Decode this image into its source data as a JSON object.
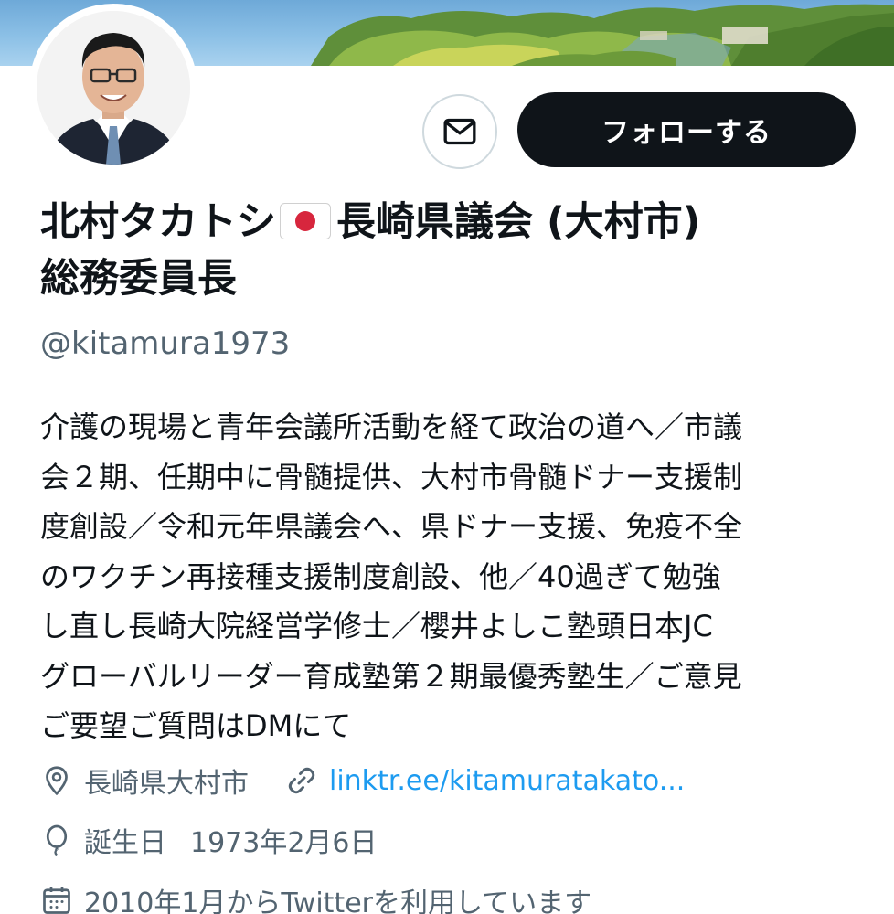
{
  "profile": {
    "name_part1": "北村タカトシ",
    "name_part2": "長崎県議会 (大村市)",
    "name_line2": "総務委員長",
    "flag_icon": "japan-flag-icon",
    "handle": "@kitamura1973",
    "bio": "介護の現場と青年会議所活動を経て政治の道へ／市議\n会２期、任期中に骨髄提供、大村市骨髄ドナー支援制\n度創設／令和元年県議会へ、県ドナー支援、免疫不全\nのワクチン再接種支援制度創設、他／40過ぎて勉強\nし直し長崎大院経営学修士／櫻井よしこ塾頭日本JC\nグローバルリーダー育成塾第２期最優秀塾生／ご意見\nご要望ご質問はDMにて",
    "location": "長崎県大村市",
    "link": "linktr.ee/kitamuratakato...",
    "birthday_label": "誕生日",
    "birthday_value": "1973年2月6日",
    "joined": "2010年1月からTwitterを利用しています"
  },
  "actions": {
    "follow_label": "フォローする",
    "message_icon": "envelope-icon"
  },
  "colors": {
    "primary_text": "#0f1419",
    "secondary_text": "#536471",
    "link": "#1d9bf0",
    "button_bg": "#0f1419"
  }
}
